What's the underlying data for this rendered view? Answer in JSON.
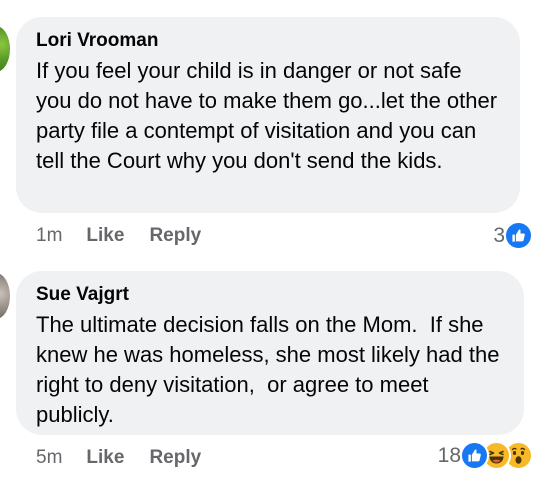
{
  "comments": [
    {
      "author": "Lori Vrooman",
      "text": "If you feel your child is in danger or not safe you do not have to make them go...let the other party file a contempt of visitation and you can tell the Court why you don't send the kids.",
      "time": "1m",
      "like_label": "Like",
      "reply_label": "Reply",
      "reaction_count": "3",
      "reaction_icons": [
        "like-icon"
      ]
    },
    {
      "author": "Sue Vajgrt",
      "text": "The ultimate decision falls on the Mom.  If she knew he was homeless, she most likely had the right to deny visitation,  or agree to meet publicly.",
      "time": "5m",
      "like_label": "Like",
      "reply_label": "Reply",
      "reaction_count": "18",
      "reaction_icons": [
        "like-icon",
        "haha-icon",
        "wow-icon"
      ]
    }
  ],
  "colors": {
    "bubble_bg": "#eff1f3",
    "meta_text": "#65676b",
    "like_blue": "#1877f2",
    "emoji_yellow": "#f7b928"
  }
}
